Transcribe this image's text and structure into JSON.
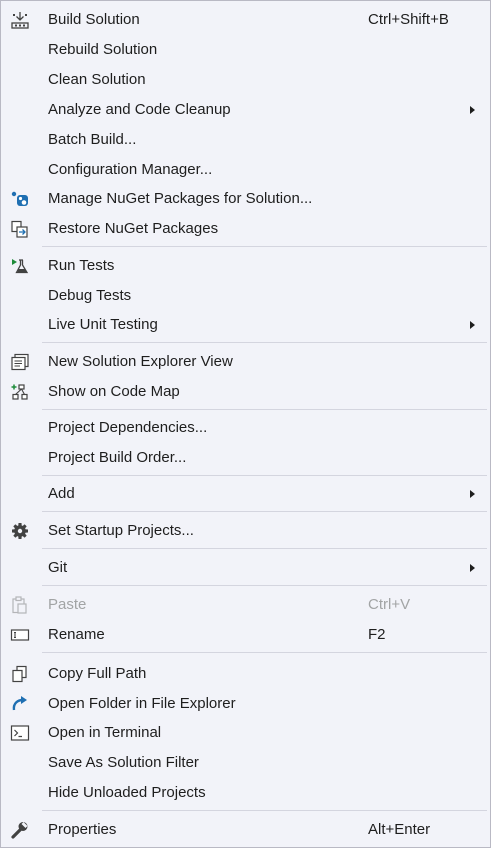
{
  "menu": {
    "items": [
      {
        "label": "Build Solution",
        "shortcut": "Ctrl+Shift+B",
        "icon": "build-icon"
      },
      {
        "label": "Rebuild Solution"
      },
      {
        "label": "Clean Solution"
      },
      {
        "label": "Analyze and Code Cleanup",
        "submenu": true
      },
      {
        "label": "Batch Build..."
      },
      {
        "label": "Configuration Manager..."
      },
      {
        "label": "Manage NuGet Packages for Solution...",
        "icon": "nuget-icon"
      },
      {
        "label": "Restore NuGet Packages",
        "icon": "restore-packages-icon"
      },
      {
        "label": "Run Tests",
        "icon": "run-tests-icon"
      },
      {
        "label": "Debug Tests"
      },
      {
        "label": "Live Unit Testing",
        "submenu": true
      },
      {
        "label": "New Solution Explorer View",
        "icon": "solution-explorer-view-icon"
      },
      {
        "label": "Show on Code Map",
        "icon": "code-map-icon"
      },
      {
        "label": "Project Dependencies..."
      },
      {
        "label": "Project Build Order..."
      },
      {
        "label": "Add",
        "submenu": true
      },
      {
        "label": "Set Startup Projects...",
        "icon": "gear-icon"
      },
      {
        "label": "Git",
        "submenu": true
      },
      {
        "label": "Paste",
        "shortcut": "Ctrl+V",
        "icon": "paste-icon",
        "disabled": true
      },
      {
        "label": "Rename",
        "shortcut": "F2",
        "icon": "rename-icon"
      },
      {
        "label": "Copy Full Path",
        "icon": "copy-icon"
      },
      {
        "label": "Open Folder in File Explorer",
        "icon": "open-folder-arrow-icon"
      },
      {
        "label": "Open in Terminal",
        "icon": "terminal-icon"
      },
      {
        "label": "Save As Solution Filter"
      },
      {
        "label": "Hide Unloaded Projects"
      },
      {
        "label": "Properties",
        "shortcut": "Alt+Enter",
        "icon": "wrench-icon"
      }
    ]
  },
  "colors": {
    "menu_background": "#f2f3f9",
    "text": "#1e1e1e",
    "disabled_text": "#a2a4a5",
    "separator": "#d4d5df",
    "accent_blue": "#1f6fb2",
    "accent_green": "#1e8c3a"
  }
}
